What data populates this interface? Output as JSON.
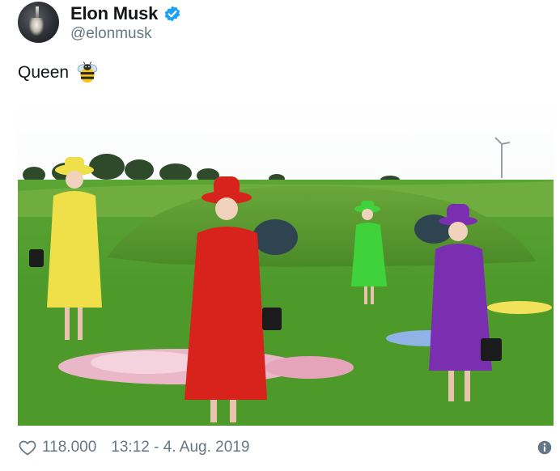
{
  "author": {
    "display_name": "Elon Musk",
    "handle": "@elonmusk",
    "verified": true,
    "verified_icon": "verified-badge-icon",
    "verified_color": "#1da1f2"
  },
  "tweet": {
    "text": "Queen",
    "emoji": "bee-emoji"
  },
  "media": {
    "type": "photo",
    "figures": [
      {
        "outfit_color": "#efe04a"
      },
      {
        "outfit_color": "#d8231d"
      },
      {
        "outfit_color": "#3fd23a"
      },
      {
        "outfit_color": "#7a2fb0"
      }
    ]
  },
  "footer": {
    "likes": "118.000",
    "like_icon": "heart-icon",
    "timestamp": "13:12 - 4. Aug. 2019",
    "info_icon": "info-icon"
  },
  "colors": {
    "text_primary": "#14171a",
    "text_secondary": "#657786",
    "grass": "#4f9a2c"
  }
}
